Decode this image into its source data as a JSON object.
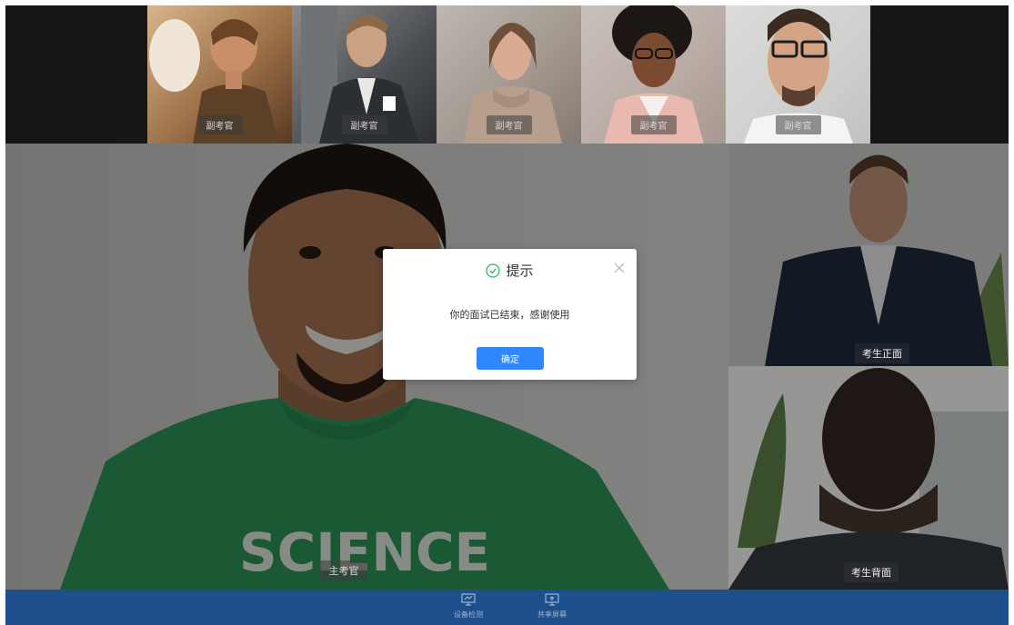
{
  "examiners": [
    {
      "label": "副考官",
      "bg": "#b58e64"
    },
    {
      "label": "副考官",
      "bg": "#6d6a66"
    },
    {
      "label": "副考官",
      "bg": "#a69b92"
    },
    {
      "label": "副考官",
      "bg": "#c6a397"
    },
    {
      "label": "副考官",
      "bg": "#d1d1cf"
    }
  ],
  "main_feed": {
    "label": "主考官",
    "shirt_text": "SCIENCE",
    "shirt_color": "#2f9a5c"
  },
  "side_feeds": {
    "front_label": "考生正面",
    "back_label": "考生背面"
  },
  "toolbar": {
    "device_check": "设备检测",
    "share_screen": "共享屏幕",
    "bar_color": "#1d4f8c"
  },
  "dialog": {
    "title": "提示",
    "message": "你的面试已结束，感谢使用",
    "ok_label": "确定",
    "accent": "#2f86ff",
    "success_color": "#35b06a"
  }
}
